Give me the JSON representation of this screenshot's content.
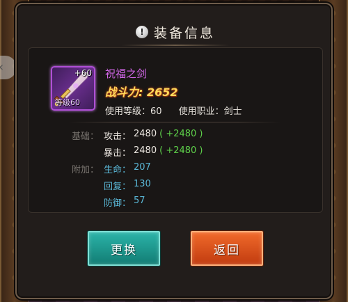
{
  "dialog": {
    "title": "装备信息",
    "alert_icon": "exclamation-icon"
  },
  "item": {
    "name": "祝福之剑",
    "enhance": "+60",
    "level_tag": "等级60",
    "power_label": "战斗力:",
    "power_value": "2652",
    "req_level_label": "使用等级：",
    "req_level": "60",
    "req_class_label": "使用职业：",
    "req_class": "剑士",
    "icon": "sword-icon",
    "frame_color": "#b04fd6"
  },
  "stats": {
    "base_label": "基础：",
    "extra_label": "附加：",
    "base": [
      {
        "name": "攻击：",
        "value": "2480",
        "bonus": "( +2480 )"
      },
      {
        "name": "暴击：",
        "value": "2480",
        "bonus": "( +2480 )"
      }
    ],
    "extra": [
      {
        "name": "生命：",
        "value": "207"
      },
      {
        "name": "回复：",
        "value": "130"
      },
      {
        "name": "防御：",
        "value": "57"
      }
    ]
  },
  "buttons": {
    "replace": "更换",
    "return": "返回"
  },
  "colors": {
    "bonus": "#5ed14a",
    "extra_stat": "#5ab7d6",
    "item_name": "#d066e6",
    "power": "#ffd95a"
  }
}
